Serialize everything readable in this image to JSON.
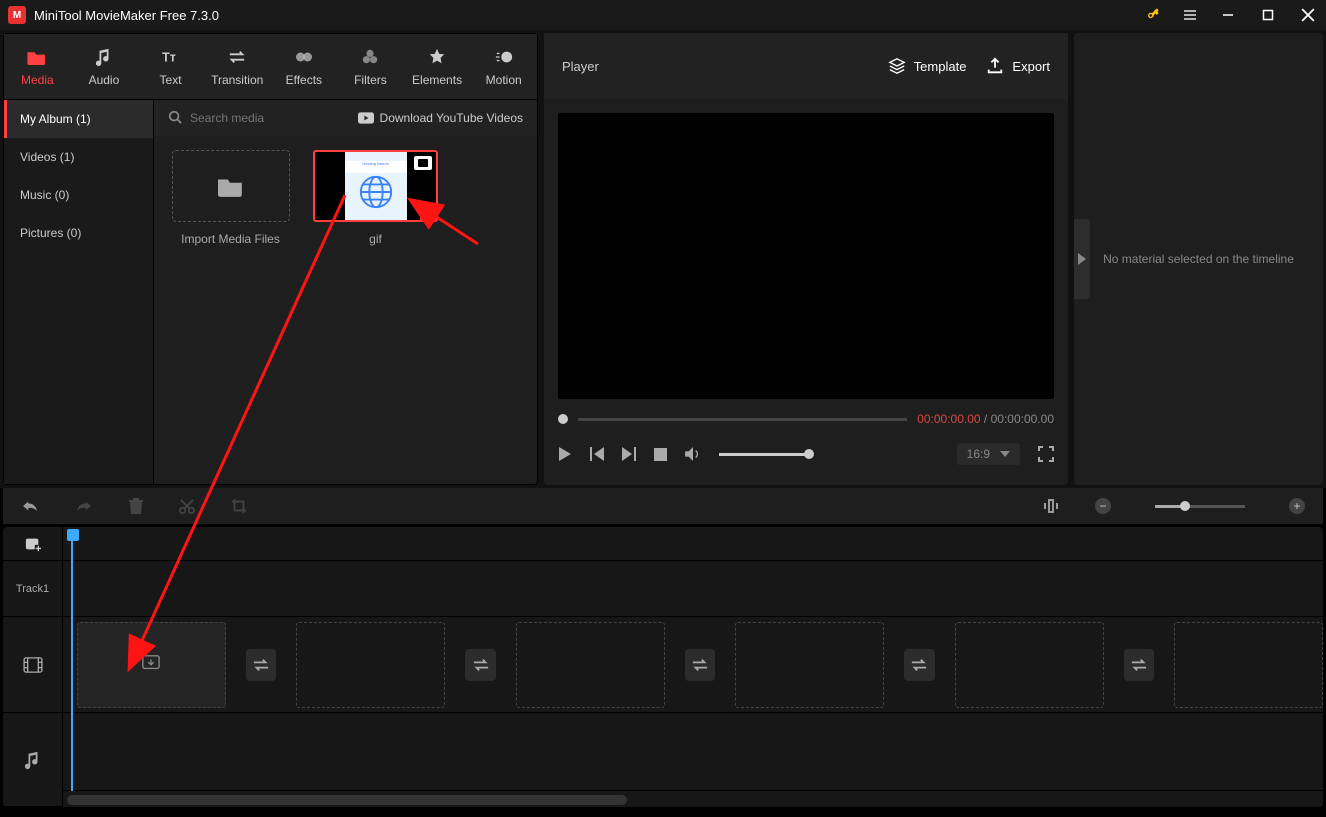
{
  "app": {
    "title": "MiniTool MovieMaker Free 7.3.0"
  },
  "tabs": [
    {
      "label": "Media",
      "icon": "folder"
    },
    {
      "label": "Audio",
      "icon": "music-note"
    },
    {
      "label": "Text",
      "icon": "text"
    },
    {
      "label": "Transition",
      "icon": "swap"
    },
    {
      "label": "Effects",
      "icon": "sparkles"
    },
    {
      "label": "Filters",
      "icon": "circles"
    },
    {
      "label": "Elements",
      "icon": "star"
    },
    {
      "label": "Motion",
      "icon": "motion"
    }
  ],
  "mediaSidebar": {
    "items": [
      {
        "label": "My Album (1)",
        "active": true
      },
      {
        "label": "Videos (1)"
      },
      {
        "label": "Music (0)"
      },
      {
        "label": "Pictures (0)"
      }
    ]
  },
  "search": {
    "placeholder": "Search media"
  },
  "downloadLink": "Download YouTube Videos",
  "mediaItems": {
    "importLabel": "Import Media Files",
    "clipLabel": "gif",
    "thumbHeader": "Hosting Needs"
  },
  "player": {
    "title": "Player",
    "templateBtn": "Template",
    "exportBtn": "Export",
    "currentTime": "00:00:00.00",
    "separator": " / ",
    "totalTime": "00:00:00.00",
    "aspect": "16:9"
  },
  "props": {
    "emptyText": "No material selected on the timeline"
  },
  "timeline": {
    "trackLabel": "Track1"
  }
}
